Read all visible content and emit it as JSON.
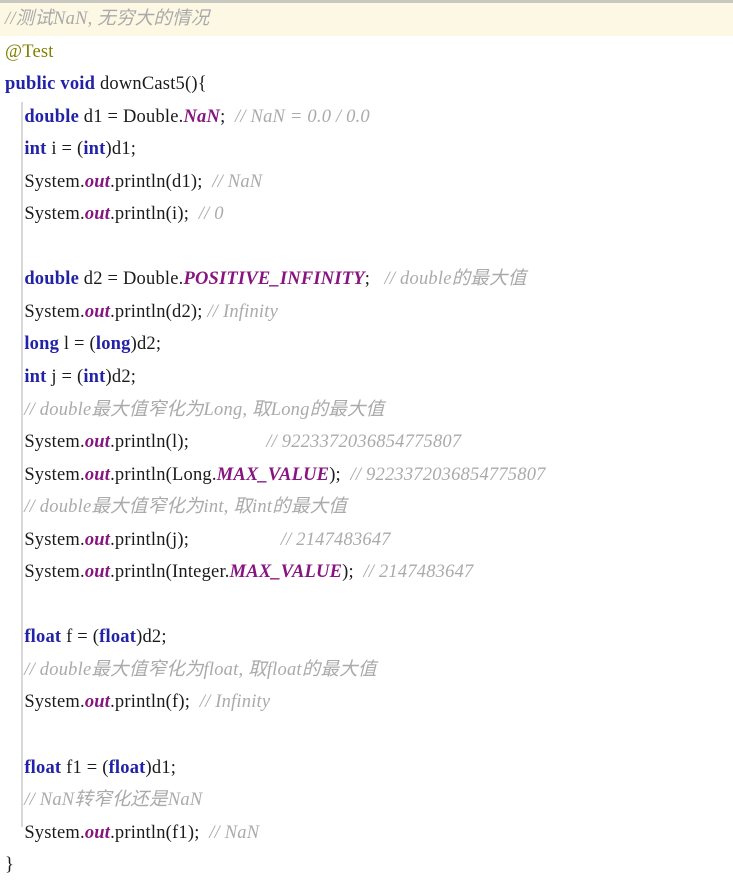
{
  "editor": {
    "language": "java",
    "colors": {
      "background": "#ffffff",
      "keyword": "#2222a8",
      "comment": "#aaaaaa",
      "constant": "#87157f",
      "annotation": "#808000",
      "highlight_band": "#fdf8e3",
      "indent_guide": "#d8d8d8",
      "top_border": "#c8c8c0",
      "plain_text": "#1a1a1a"
    },
    "indent_guide_visible": true
  },
  "code": {
    "l01_comment": "//测试NaN, 无穷大的情况",
    "l02_annotation": "@Test",
    "l03": {
      "kw_public": "public",
      "kw_void": "void",
      "name": " downCast5",
      "tail": "(){"
    },
    "l04": {
      "indent": "    ",
      "kw": "double",
      "mid": " d1 = Double.",
      "const": "NaN",
      "semi": ";",
      "comment": "  // NaN = 0.0 / 0.0"
    },
    "l05": {
      "indent": "    ",
      "kw1": "int",
      "mid1": " i = (",
      "kw2": "int",
      "tail": ")d1;"
    },
    "l06": {
      "indent": "    ",
      "pre": "System.",
      "const": "out",
      "mid": ".println(d1);",
      "comment": "  // NaN"
    },
    "l07": {
      "indent": "    ",
      "pre": "System.",
      "const": "out",
      "mid": ".println(i);",
      "comment": "  // 0"
    },
    "l08_blank": "",
    "l09": {
      "indent": "    ",
      "kw": "double",
      "mid": " d2 = Double.",
      "const": "POSITIVE_INFINITY",
      "semi": ";",
      "comment": "   // double的最大值"
    },
    "l10": {
      "indent": "    ",
      "pre": "System.",
      "const": "out",
      "mid": ".println(d2);",
      "comment": " // Infinity"
    },
    "l11": {
      "indent": "    ",
      "kw1": "long",
      "mid1": " l = (",
      "kw2": "long",
      "tail": ")d2;"
    },
    "l12": {
      "indent": "    ",
      "kw1": "int",
      "mid1": " j = (",
      "kw2": "int",
      "tail": ")d2;"
    },
    "l13_comment": "    // double最大值窄化为Long, 取Long的最大值",
    "l14": {
      "indent": "    ",
      "pre": "System.",
      "const": "out",
      "mid": ".println(l);",
      "comment": "                // 9223372036854775807"
    },
    "l15": {
      "indent": "    ",
      "pre": "System.",
      "const": "out",
      "mid": ".println(Long.",
      "const2": "MAX_VALUE",
      "mid2": ");",
      "comment": "  // 9223372036854775807"
    },
    "l16_comment": "    // double最大值窄化为int, 取int的最大值",
    "l17": {
      "indent": "    ",
      "pre": "System.",
      "const": "out",
      "mid": ".println(j);",
      "comment": "                   // 2147483647"
    },
    "l18": {
      "indent": "    ",
      "pre": "System.",
      "const": "out",
      "mid": ".println(Integer.",
      "const2": "MAX_VALUE",
      "mid2": ");",
      "comment": "  // 2147483647"
    },
    "l19_blank": "",
    "l20": {
      "indent": "    ",
      "kw1": "float",
      "mid1": " f = (",
      "kw2": "float",
      "tail": ")d2;"
    },
    "l21_comment": "    // double最大值窄化为float, 取float的最大值",
    "l22": {
      "indent": "    ",
      "pre": "System.",
      "const": "out",
      "mid": ".println(f);",
      "comment": "  // Infinity"
    },
    "l23_blank": "",
    "l24": {
      "indent": "    ",
      "kw1": "float",
      "mid1": " f1 = (",
      "kw2": "float",
      "tail": ")d1;"
    },
    "l25_comment": "    // NaN转窄化还是NaN",
    "l26": {
      "indent": "    ",
      "pre": "System.",
      "const": "out",
      "mid": ".println(f1);",
      "comment": "  // NaN"
    },
    "l27_close": "}"
  }
}
